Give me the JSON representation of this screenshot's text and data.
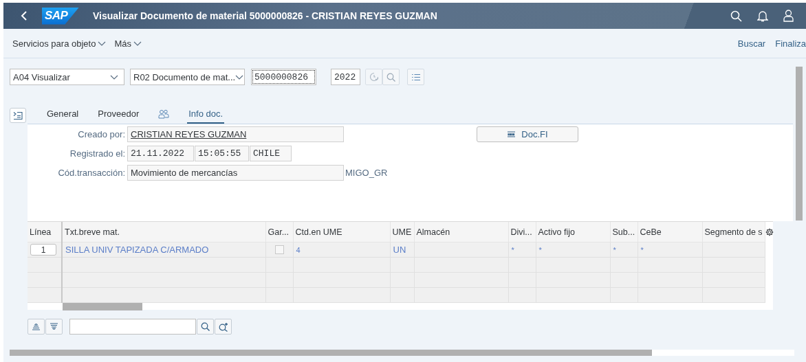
{
  "header": {
    "logo": "SAP",
    "title": "Visualizar Documento de material 5000000826 - CRISTIAN REYES GUZMAN"
  },
  "toolbar": {
    "menus": [
      "Servicios para objeto",
      "Más"
    ],
    "actions": [
      "Buscar",
      "Finaliza"
    ]
  },
  "selection": {
    "action": "A04 Visualizar",
    "reference": "R02 Documento de mat...",
    "document_number": "5000000826",
    "year": "2022"
  },
  "tabs": [
    {
      "kind": "text",
      "label": "General",
      "selected": false
    },
    {
      "kind": "text",
      "label": "Proveedor",
      "selected": false
    },
    {
      "kind": "icon",
      "selected": false
    },
    {
      "kind": "text",
      "label": "Info doc.",
      "selected": true
    }
  ],
  "form": {
    "created_by": {
      "label": "Creado por:",
      "value": "CRISTIAN REYES GUZMAN"
    },
    "registered": {
      "label": "Registrado el:",
      "date": "21.11.2022",
      "time": "15:05:55",
      "zone": "CHILE"
    },
    "transaction": {
      "label": "Cód.transacción:",
      "value": "Movimiento de mercancías",
      "code": "MIGO_GR"
    },
    "doc_fi_button": "Doc.FI"
  },
  "table": {
    "columns": [
      "Línea",
      "Txt.breve mat.",
      "Gar...",
      "Ctd.en UME",
      "UME",
      "Almacén",
      "Divi...",
      "Activo fijo",
      "Sub...",
      "CeBe",
      "Segmento de s"
    ],
    "rows": [
      {
        "line": "1",
        "material_text": "SILLA UNIV TAPIZADA C/ARMADO",
        "guarantee_checked": false,
        "quantity": "4",
        "unit": "UN",
        "division": "*",
        "fixed_asset": "*",
        "sub": "*",
        "profit_center": "*"
      }
    ]
  }
}
